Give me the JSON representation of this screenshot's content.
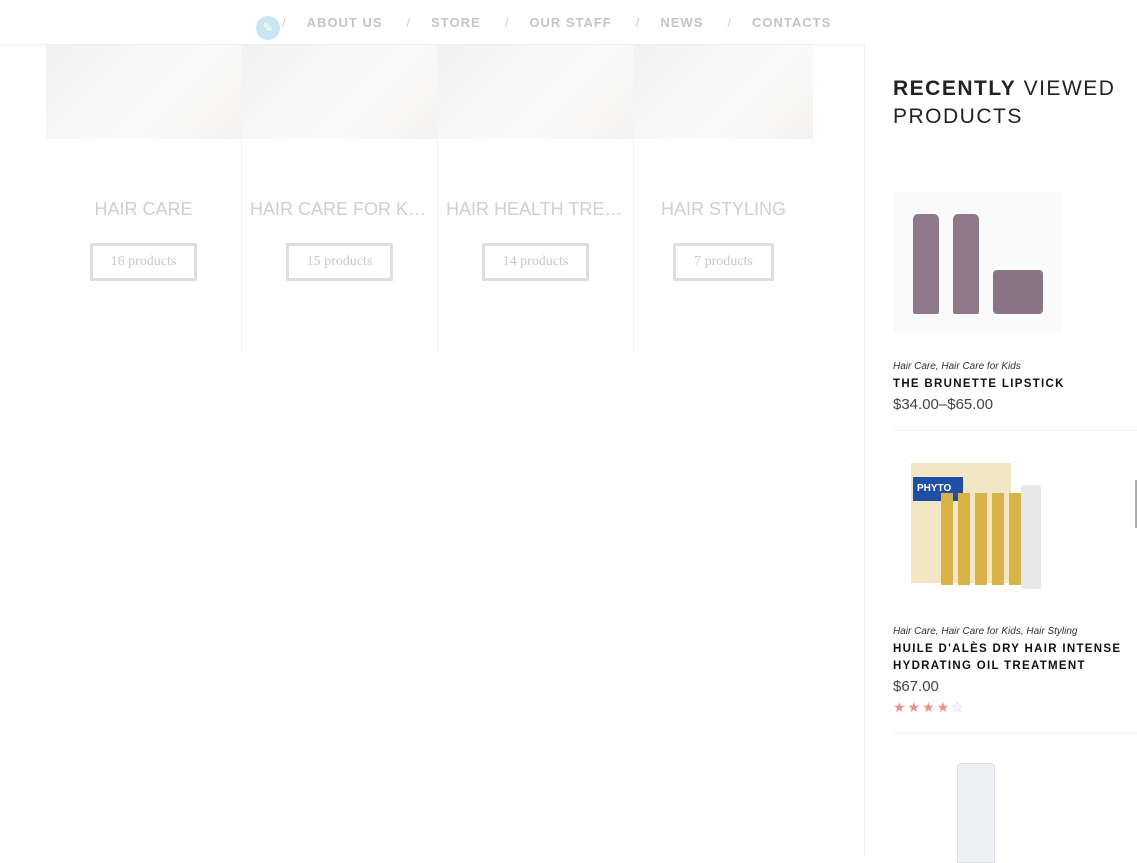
{
  "nav": {
    "items": [
      "ABOUT US",
      "STORE",
      "OUR STAFF",
      "NEWS",
      "CONTACTS"
    ]
  },
  "categories": [
    {
      "title": "HAIR CARE",
      "count": "16 products"
    },
    {
      "title": "HAIR CARE FOR KIDS",
      "count": "15 products"
    },
    {
      "title": "HAIR HEALTH TREATMENTS",
      "count": "14 products"
    },
    {
      "title": "HAIR STYLING",
      "count": "7 products"
    }
  ],
  "sidebar": {
    "title_bold": "RECENTLY",
    "title_rest": "VIEWED PRODUCTS",
    "products": [
      {
        "categories": "Hair Care, Hair Care for Kids",
        "name": "THE BRUNETTE LIPSTICK",
        "price": "$34.00–$65.00"
      },
      {
        "categories": "Hair Care, Hair Care for Kids, Hair Styling",
        "name": "HUILE D'ALÈS DRY HAIR INTENSE HYDRATING OIL TREATMENT",
        "price": "$67.00",
        "rating": 4,
        "rating_max": 5,
        "brand": "PHYTO"
      }
    ]
  },
  "colors": {
    "star": "#f0908a",
    "logo": "#c9e6f3"
  }
}
